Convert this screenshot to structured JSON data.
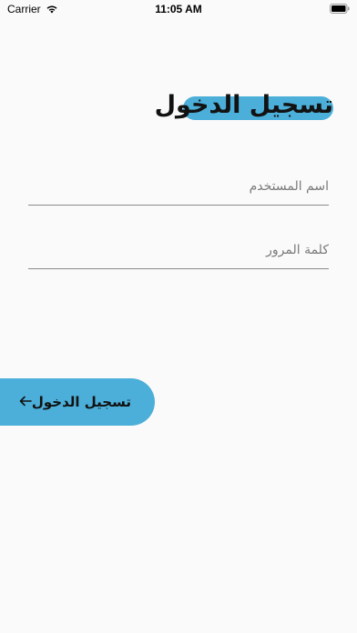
{
  "status_bar": {
    "carrier": "Carrier",
    "time": "11:05 AM",
    "wifi_icon": "wifi-icon",
    "battery_icon": "battery-icon"
  },
  "title": "تسجيل الدخول",
  "form": {
    "username": {
      "placeholder": "اسم المستخدم",
      "value": ""
    },
    "password": {
      "placeholder": "كلمة المرور",
      "value": ""
    }
  },
  "login_button": {
    "label": "تسجيل الدخول",
    "icon": "arrow-left-icon"
  },
  "colors": {
    "accent": "#4bafd9",
    "background": "#fafafa",
    "text": "#121212"
  }
}
